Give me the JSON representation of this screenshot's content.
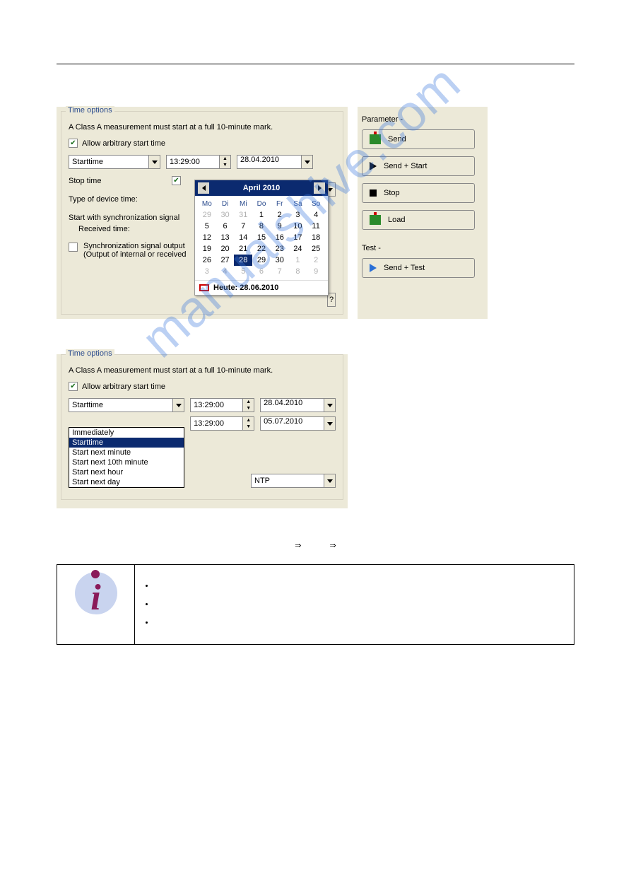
{
  "watermark": "manualshive.com",
  "panel1": {
    "legend": "Time options",
    "note": "A Class A measurement must start at a full 10-minute mark.",
    "allow_arbitrary": "Allow arbitrary start time",
    "starttime_label": "Starttime",
    "starttime_time": "13:29:00",
    "starttime_date": "28.04.2010",
    "stop_label": "Stop time",
    "type_device_time": "Type of device time:",
    "start_sync": "Start with synchronization signal",
    "received_time": "Received time:",
    "sync_out1": "Synchronization signal output",
    "sync_out2": "(Output of internal or received"
  },
  "calendar": {
    "month": "April 2010",
    "days": [
      "Mo",
      "Di",
      "Mi",
      "Do",
      "Fr",
      "Sa",
      "So"
    ],
    "weeks": [
      [
        {
          "n": "29",
          "m": true
        },
        {
          "n": "30",
          "m": true
        },
        {
          "n": "31",
          "m": true
        },
        {
          "n": "1"
        },
        {
          "n": "2"
        },
        {
          "n": "3"
        },
        {
          "n": "4"
        }
      ],
      [
        {
          "n": "5"
        },
        {
          "n": "6"
        },
        {
          "n": "7"
        },
        {
          "n": "8"
        },
        {
          "n": "9"
        },
        {
          "n": "10"
        },
        {
          "n": "11"
        }
      ],
      [
        {
          "n": "12"
        },
        {
          "n": "13"
        },
        {
          "n": "14"
        },
        {
          "n": "15"
        },
        {
          "n": "16"
        },
        {
          "n": "17"
        },
        {
          "n": "18"
        }
      ],
      [
        {
          "n": "19"
        },
        {
          "n": "20"
        },
        {
          "n": "21"
        },
        {
          "n": "22"
        },
        {
          "n": "23"
        },
        {
          "n": "24"
        },
        {
          "n": "25"
        }
      ],
      [
        {
          "n": "26"
        },
        {
          "n": "27"
        },
        {
          "n": "28",
          "sel": true
        },
        {
          "n": "29"
        },
        {
          "n": "30"
        },
        {
          "n": "1",
          "m": true
        },
        {
          "n": "2",
          "m": true
        }
      ],
      [
        {
          "n": "3",
          "m": true
        },
        {
          "n": "4",
          "m": true
        },
        {
          "n": "5",
          "m": true
        },
        {
          "n": "6",
          "m": true
        },
        {
          "n": "7",
          "m": true
        },
        {
          "n": "8",
          "m": true
        },
        {
          "n": "9",
          "m": true
        }
      ]
    ],
    "today": "Heute: 28.06.2010"
  },
  "right": {
    "param_label": "Parameter -",
    "btn_send": "Send",
    "btn_send_start": "Send + Start",
    "btn_stop": "Stop",
    "btn_load": "Load",
    "test_label": "Test -",
    "btn_send_test": "Send + Test"
  },
  "panel2": {
    "legend": "Time options",
    "note": "A Class A measurement must start at a full 10-minute mark.",
    "allow_arbitrary": "Allow arbitrary start time",
    "starttime_label": "Starttime",
    "starttime_time": "13:29:00",
    "starttime_date": "28.04.2010",
    "row2_time": "13:29:00",
    "row2_date": "05.07.2010",
    "ntp": "NTP",
    "list": [
      "Immediately",
      "Starttime",
      "Start next minute",
      "Start next 10th minute",
      "Start next hour",
      "Start next day"
    ],
    "list_selected_index": 1
  },
  "arrows": {
    "a1": "⇒",
    "a2": "⇒"
  },
  "info": {
    "items": [
      "",
      "",
      ""
    ]
  }
}
